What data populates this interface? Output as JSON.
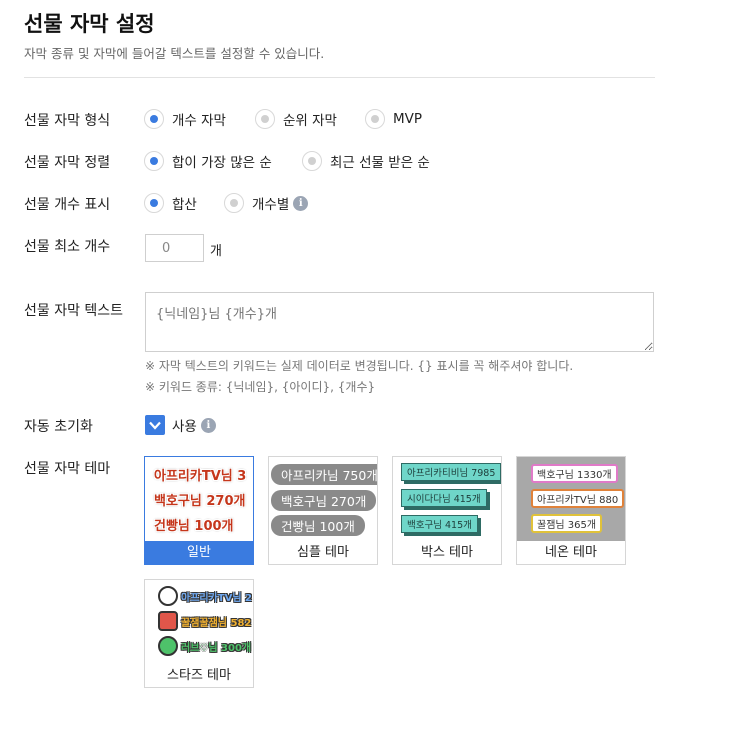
{
  "header": {
    "title": "선물 자막 설정",
    "subtitle": "자막 종류 및 자막에 들어갈 텍스트를 설정할 수 있습니다."
  },
  "type_row": {
    "label": "선물 자막 형식",
    "options": [
      {
        "label": "개수 자막",
        "checked": true
      },
      {
        "label": "순위 자막",
        "checked": false
      },
      {
        "label": "MVP",
        "checked": false
      }
    ]
  },
  "sort_row": {
    "label": "선물 자막 정렬",
    "options": [
      {
        "label": "합이 가장 많은 순",
        "checked": true
      },
      {
        "label": "최근 선물 받은 순",
        "checked": false
      }
    ]
  },
  "count_row": {
    "label": "선물 개수 표시",
    "options": [
      {
        "label": "합산",
        "checked": true
      },
      {
        "label": "개수별",
        "checked": false
      }
    ],
    "info_glyph": "i"
  },
  "min_row": {
    "label": "선물 최소 개수",
    "value": "0",
    "unit": "개"
  },
  "text_row": {
    "label": "선물 자막 텍스트",
    "placeholder": "{닉네임}님 {개수}개",
    "note1": "※ 자막 텍스트의 키워드는 실제 데이터로 변경됩니다. {} 표시를 꼭 해주셔야 합니다.",
    "note2": "※ 키워드 종류: {닉네임}, {아이디}, {개수}"
  },
  "reset_row": {
    "label": "자동 초기화",
    "checkbox_label": "사용",
    "checked": true,
    "info_glyph": "i"
  },
  "theme_row": {
    "label": "선물 자막 테마",
    "themes": [
      {
        "name": "일반",
        "selected": true,
        "lines": [
          "아프리카TV님 3",
          "백호구님 270개",
          "건빵님 100개"
        ]
      },
      {
        "name": "심플 테마",
        "selected": false,
        "lines": [
          "아프리카님 750개",
          "백호구님 270개",
          "건빵님 100개"
        ]
      },
      {
        "name": "박스 테마",
        "selected": false,
        "lines": [
          "아프리카티비님 7985",
          "시이다다님 415개",
          "백호구님 415개"
        ]
      },
      {
        "name": "네온 테마",
        "selected": false,
        "lines": [
          "백호구님 1330개",
          "아프리카TV님 880",
          "꿀잼님 365개"
        ]
      },
      {
        "name": "스타즈 테마",
        "selected": false,
        "lines": [
          "아프리카TV님 2",
          "꿀잼꿀잼님 582",
          "러브♡님 300개"
        ]
      }
    ]
  },
  "colors": {
    "accent": "#3a7be0",
    "general_text": "#c5361b",
    "simple_pill": "#8a8a8a",
    "box_fill": "#6fd6c9",
    "neon_border_1": "#e07ac8",
    "neon_border_2": "#e0823a",
    "neon_border_3": "#e0c23a",
    "stars_text_1": "#6fa8f0",
    "stars_text_2": "#f0b030",
    "stars_text_3": "#4ec26a"
  }
}
